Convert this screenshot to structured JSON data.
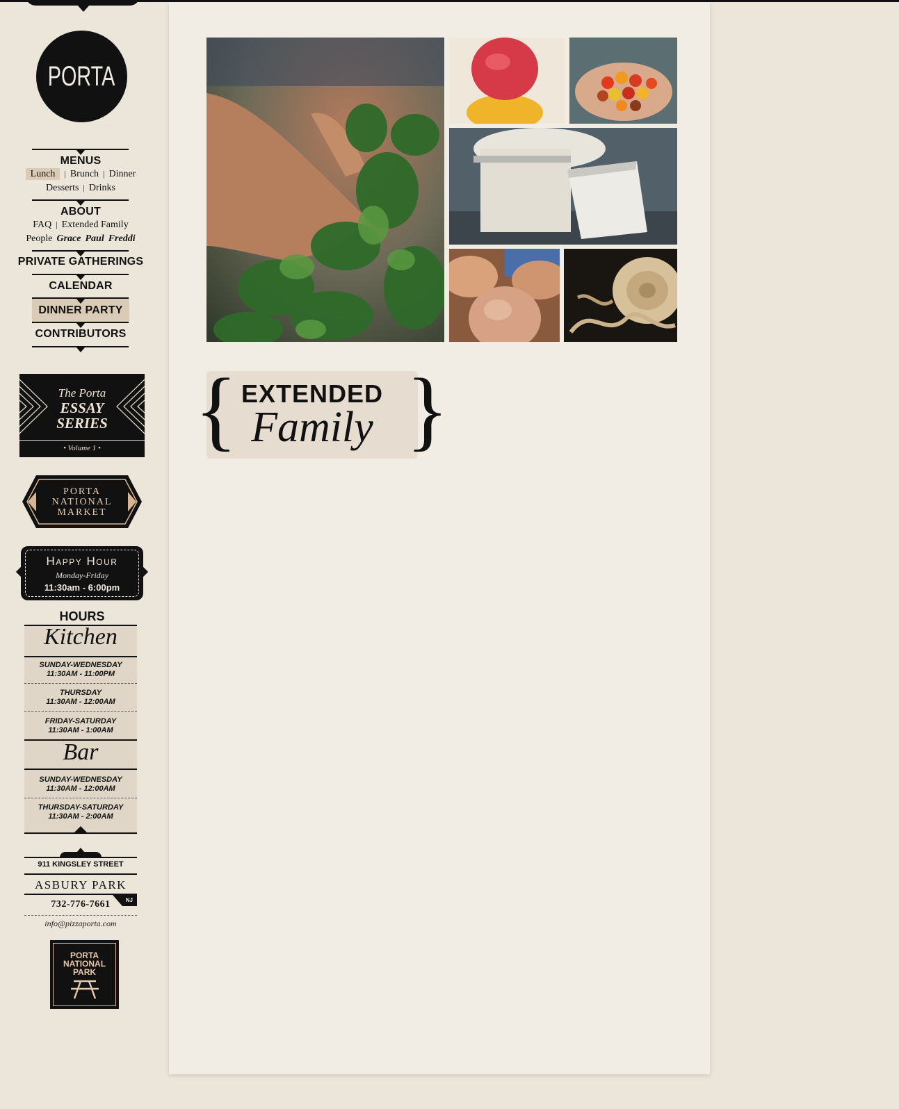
{
  "logo": {
    "text": "PORTA"
  },
  "nav": {
    "menus": {
      "heading": "MENUS",
      "row1": [
        "Lunch",
        "Brunch",
        "Dinner"
      ],
      "row2": [
        "Desserts",
        "Drinks"
      ]
    },
    "about": {
      "heading": "ABOUT",
      "row1": [
        "FAQ",
        "Extended Family"
      ],
      "row2_label": "People",
      "people": [
        "Grace",
        "Paul",
        "Freddi"
      ]
    },
    "private_gatherings": "PRIVATE GATHERINGS",
    "calendar": "CALENDAR",
    "dinner_party": "DINNER PARTY",
    "contributors": "CONTRIBUTORS",
    "separator": "|"
  },
  "essay": {
    "line1": "The Porta",
    "line2": "ESSAY",
    "line3": "SERIES",
    "volume": "• Volume 1 •"
  },
  "market": {
    "line1": "PORTA",
    "line2": "NATIONAL",
    "line3": "MARKET"
  },
  "happy_hour": {
    "title": "Happy Hour",
    "days": "Monday-Friday",
    "time": "11:30am - 6:00pm"
  },
  "hours": {
    "title": "HOURS",
    "kitchen": {
      "label": "Kitchen",
      "slots": [
        {
          "days": "SUNDAY-WEDNESDAY",
          "time": "11:30AM - 11:00PM"
        },
        {
          "days": "THURSDAY",
          "time": "11:30AM - 12:00AM"
        },
        {
          "days": "FRIDAY-SATURDAY",
          "time": "11:30AM - 1:00AM"
        }
      ]
    },
    "bar": {
      "label": "Bar",
      "slots": [
        {
          "days": "SUNDAY-WEDNESDAY",
          "time": "11:30AM - 12:00AM"
        },
        {
          "days": "THURSDAY-SATURDAY",
          "time": "11:30AM - 2:00AM"
        }
      ]
    }
  },
  "address": {
    "street": "911 KINGSLEY STREET",
    "city": "ASBURY PARK",
    "state": "NJ",
    "phone": "732-776-7661",
    "email": "info@pizzaporta.com"
  },
  "park": {
    "line1": "PORTA",
    "line2": "NATIONAL",
    "line3": "PARK"
  },
  "main": {
    "heading_top": "EXTENDED",
    "heading_bottom": "Family",
    "photos": [
      "greens-photo",
      "sorbet-photo",
      "tomatoes-photo",
      "cheese-photo",
      "eggs-photo",
      "pasta-photo"
    ]
  },
  "colors": {
    "ink": "#111111",
    "paper": "#ebe5da",
    "panel": "#f1ede5",
    "highlight": "#d9cbb5",
    "copper": "#e4cdb0"
  }
}
